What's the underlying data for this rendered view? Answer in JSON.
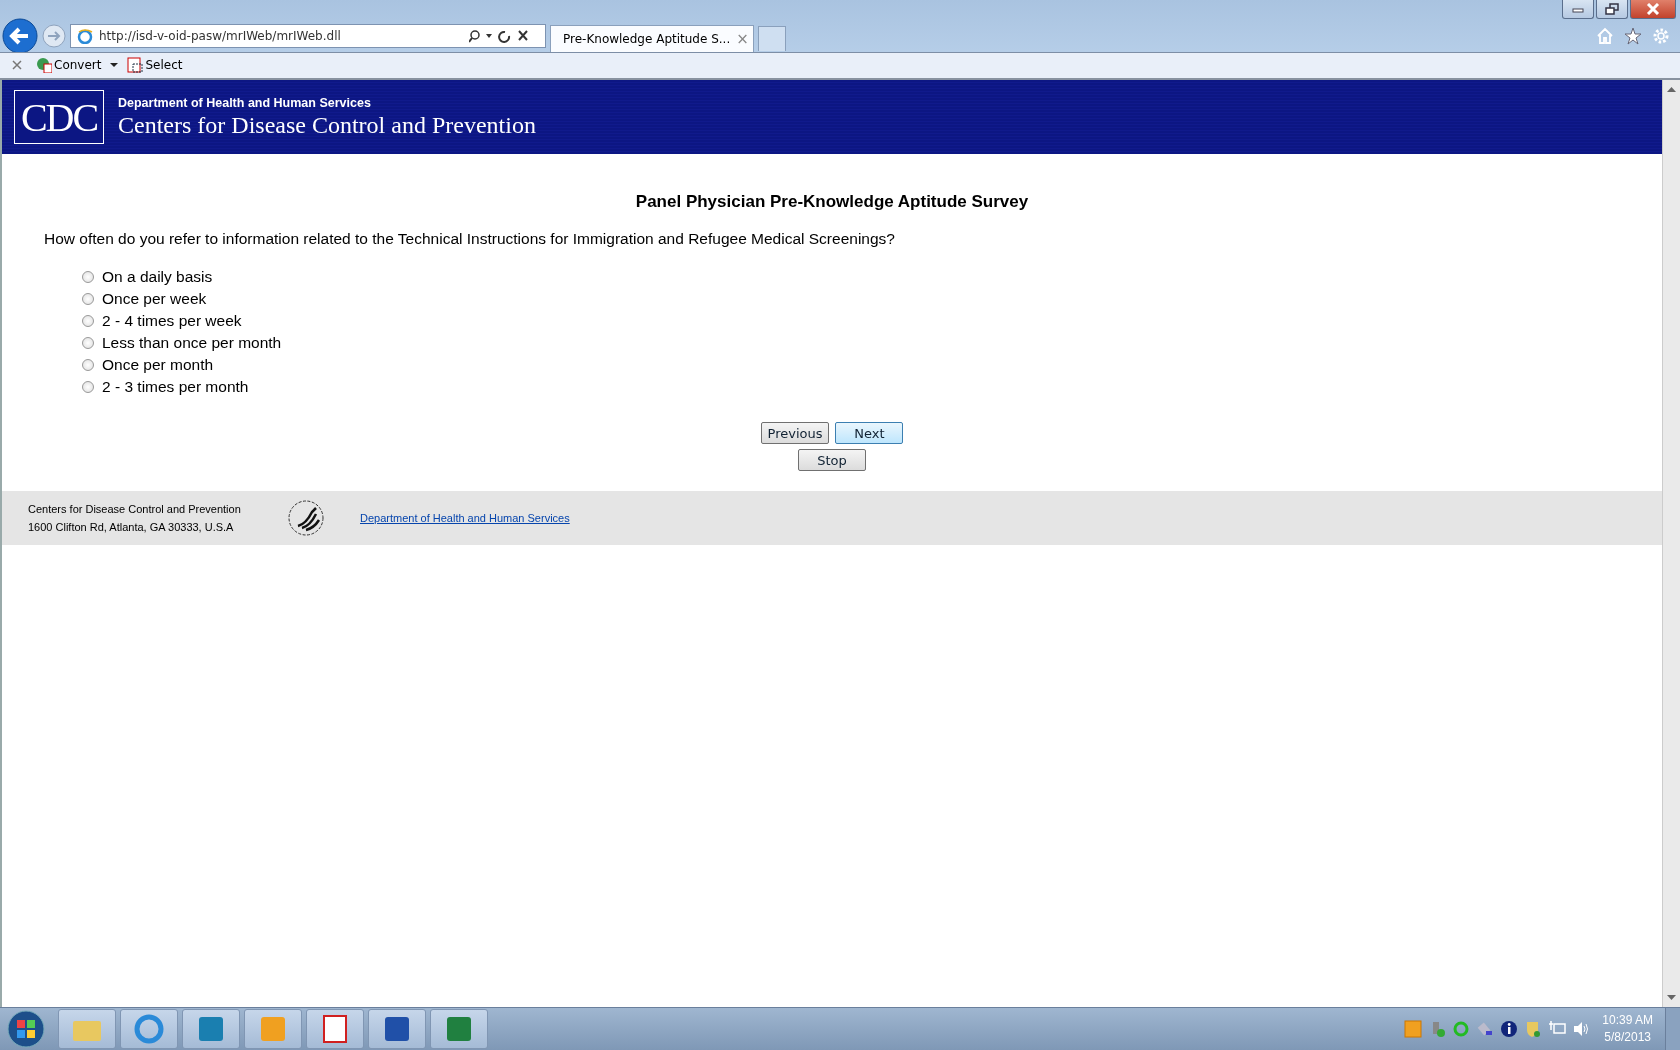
{
  "browser": {
    "address": "http://isd-v-oid-pasw/mrIWeb/mrIWeb.dll",
    "tab_title": "Pre-Knowledge Aptitude S...",
    "tab_close": "×",
    "toolbar": [
      {
        "label": "Convert",
        "kind": "convert"
      },
      {
        "label": "Select",
        "kind": "select"
      }
    ]
  },
  "header": {
    "logo": "CDC",
    "department": "Department of Health and Human Services",
    "agency": "Centers for Disease Control and Prevention"
  },
  "survey": {
    "title": "Panel Physician Pre-Knowledge Aptitude Survey",
    "question": "How often do you refer to information related to the Technical Instructions for Immigration and Refugee Medical Screenings?",
    "options": [
      {
        "label": "On a daily basis",
        "selected": false
      },
      {
        "label": "Once per week",
        "selected": false
      },
      {
        "label": "2 - 4 times per week",
        "selected": false
      },
      {
        "label": "Less than once per month",
        "selected": false
      },
      {
        "label": "Once per month",
        "selected": false
      },
      {
        "label": "2 - 3 times per month",
        "selected": false
      }
    ],
    "buttons": [
      "Previous",
      "Next",
      "Stop"
    ]
  },
  "footer": {
    "lines": [
      "Centers for Disease Control and Prevention",
      "1600 Clifton Rd, Atlanta, GA 30333, U.S.A"
    ],
    "link": "Department of Health and Human Services"
  },
  "taskbar": {
    "apps": [
      {
        "kind": "folder"
      },
      {
        "kind": "browser"
      },
      {
        "kind": "lync"
      },
      {
        "kind": "mail"
      },
      {
        "kind": "pdf"
      },
      {
        "kind": "word"
      },
      {
        "kind": "sheet"
      }
    ],
    "time": "10:39 AM",
    "date": "5/8/2013"
  }
}
